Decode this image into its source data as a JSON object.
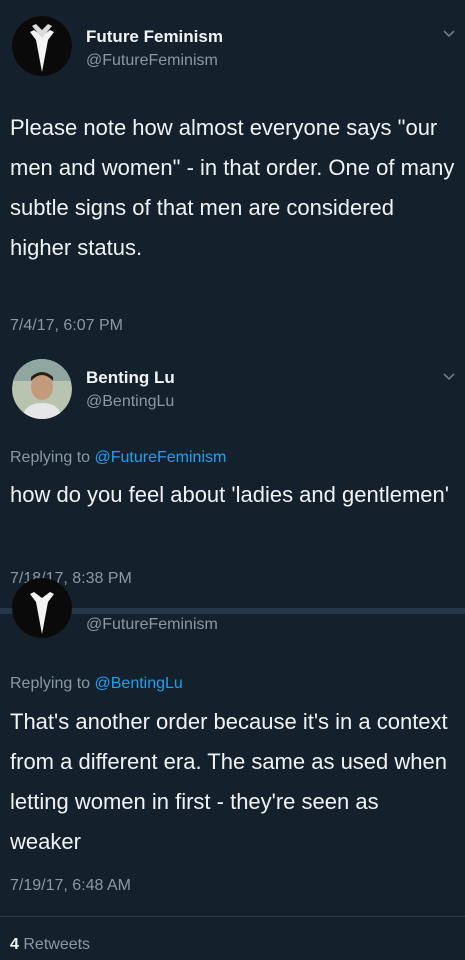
{
  "tweets": [
    {
      "name": "Future Feminism",
      "handle": "@FutureFeminism",
      "text": "Please note how almost everyone says \"our men and women\" - in that order. One of many subtle signs of that men are considered higher status.",
      "timestamp": "7/4/17, 6:07 PM"
    },
    {
      "name": "Benting Lu",
      "handle": "@BentingLu",
      "reply_prefix": "Replying to",
      "reply_to": "@FutureFeminism",
      "text": "how do you feel about 'ladies and gentlemen'",
      "timestamp": "7/18/17, 8:38 PM"
    },
    {
      "handle": "@FutureFeminism",
      "reply_prefix": "Replying to",
      "reply_to": "@BentingLu",
      "text": "That's another order because it's in a context from a different era. The same as used when letting women in first - they're seen as weaker",
      "timestamp": "7/19/17, 6:48 AM"
    }
  ],
  "retweets": {
    "count": "4",
    "label": "Retweets"
  },
  "icons": {
    "chevron": "chevron-down-icon"
  },
  "colors": {
    "background": "#14202b",
    "mention": "#1da1f2",
    "muted": "#8b98a5"
  }
}
